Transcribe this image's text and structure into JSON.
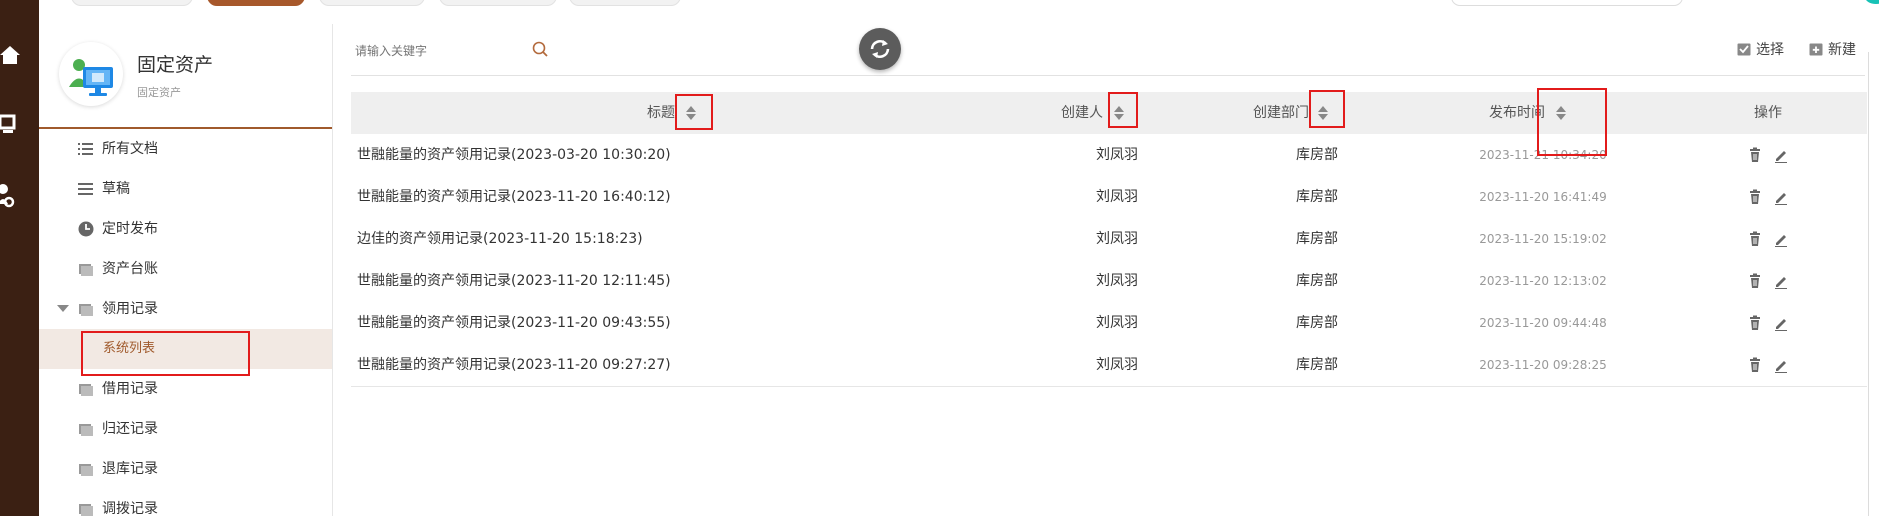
{
  "sidebar_header": {
    "title": "固定资产",
    "subtitle": "固定资产",
    "logo_icon": "computer-users-icon"
  },
  "nav": [
    {
      "label": "所有文档",
      "icon": "list-icon"
    },
    {
      "label": "草稿",
      "icon": "menu-lines-icon"
    },
    {
      "label": "定时发布",
      "icon": "clock-icon"
    },
    {
      "label": "资产台账",
      "icon": "folder-icon"
    },
    {
      "label": "领用记录",
      "icon": "folder-icon",
      "expanded": true
    },
    {
      "label": "系统列表",
      "selected": true
    },
    {
      "label": "借用记录",
      "icon": "folder-icon"
    },
    {
      "label": "归还记录",
      "icon": "folder-icon"
    },
    {
      "label": "退库记录",
      "icon": "folder-icon"
    },
    {
      "label": "调拨记录",
      "icon": "folder-icon"
    }
  ],
  "search": {
    "placeholder": "请输入关键字",
    "value": ""
  },
  "actions": {
    "select_label": "选择",
    "new_label": "新建"
  },
  "table": {
    "headers": {
      "title": "标题",
      "creator": "创建人",
      "dept": "创建部门",
      "time": "发布时间",
      "ops": "操作"
    },
    "rows": [
      {
        "title": "世融能量的资产领用记录(2023-03-20 10:30:20)",
        "creator": "刘凤羽",
        "dept": "库房部",
        "time": "2023-11-21 10:34:20"
      },
      {
        "title": "世融能量的资产领用记录(2023-11-20 16:40:12)",
        "creator": "刘凤羽",
        "dept": "库房部",
        "time": "2023-11-20 16:41:49"
      },
      {
        "title": "边佳的资产领用记录(2023-11-20 15:18:23)",
        "creator": "刘凤羽",
        "dept": "库房部",
        "time": "2023-11-20 15:19:02"
      },
      {
        "title": "世融能量的资产领用记录(2023-11-20 12:11:45)",
        "creator": "刘凤羽",
        "dept": "库房部",
        "time": "2023-11-20 12:13:02"
      },
      {
        "title": "世融能量的资产领用记录(2023-11-20 09:43:55)",
        "creator": "刘凤羽",
        "dept": "库房部",
        "time": "2023-11-20 09:44:48"
      },
      {
        "title": "世融能量的资产领用记录(2023-11-20 09:27:27)",
        "creator": "刘凤羽",
        "dept": "库房部",
        "time": "2023-11-20 09:28:25"
      }
    ]
  },
  "colors": {
    "brand": "#a05a2c",
    "rail": "#3b2013",
    "highlight": "#e21b1b"
  }
}
